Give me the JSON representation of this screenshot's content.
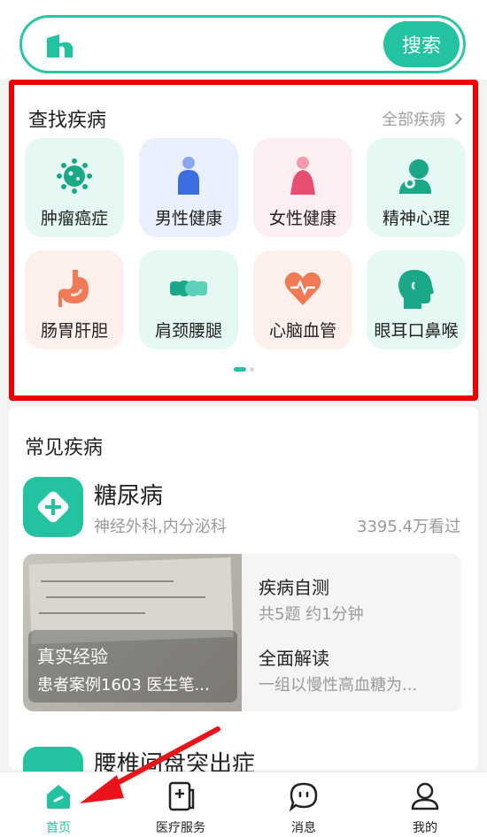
{
  "search": {
    "button_label": "搜索",
    "logo_icon": "h-logo-icon"
  },
  "find_disease": {
    "title": "查找疾病",
    "more_label": "全部疾病",
    "categories": [
      {
        "label": "肿瘤癌症",
        "icon": "virus-icon",
        "bg": "#e6f8f3"
      },
      {
        "label": "男性健康",
        "icon": "male-icon",
        "bg": "#eaf0fd"
      },
      {
        "label": "女性健康",
        "icon": "female-icon",
        "bg": "#fdeef1"
      },
      {
        "label": "精神心理",
        "icon": "mind-icon",
        "bg": "#e6f8f3"
      },
      {
        "label": "肠胃肝胆",
        "icon": "stomach-icon",
        "bg": "#fdf0ec"
      },
      {
        "label": "肩颈腰腿",
        "icon": "bones-icon",
        "bg": "#e6f8f3"
      },
      {
        "label": "心脑血管",
        "icon": "heart-icon",
        "bg": "#fdf0ec"
      },
      {
        "label": "眼耳口鼻喉",
        "icon": "head-icon",
        "bg": "#e6f8f3"
      }
    ]
  },
  "common_diseases": {
    "title": "常见疾病",
    "disease": {
      "name": "糖尿病",
      "departments": "神经外科,内分泌科",
      "views": "3395.4万看过"
    },
    "card": {
      "experience_title": "真实经验",
      "experience_sub": "患者案例1603 医生笔...",
      "selftest_title": "疾病自测",
      "selftest_sub": "共5题 约1分钟",
      "interpret_title": "全面解读",
      "interpret_sub": "一组以慢性高血糖为..."
    },
    "next_disease": "腰椎间盘突出症"
  },
  "nav": {
    "items": [
      {
        "label": "首页",
        "icon": "home-icon",
        "active": true
      },
      {
        "label": "医疗服务",
        "icon": "medical-service-icon",
        "active": false
      },
      {
        "label": "消息",
        "icon": "message-icon",
        "active": false
      },
      {
        "label": "我的",
        "icon": "profile-icon",
        "active": false
      }
    ]
  },
  "colors": {
    "accent": "#23c2a1",
    "highlight_border": "#ee0000",
    "arrow": "#e8141a"
  }
}
